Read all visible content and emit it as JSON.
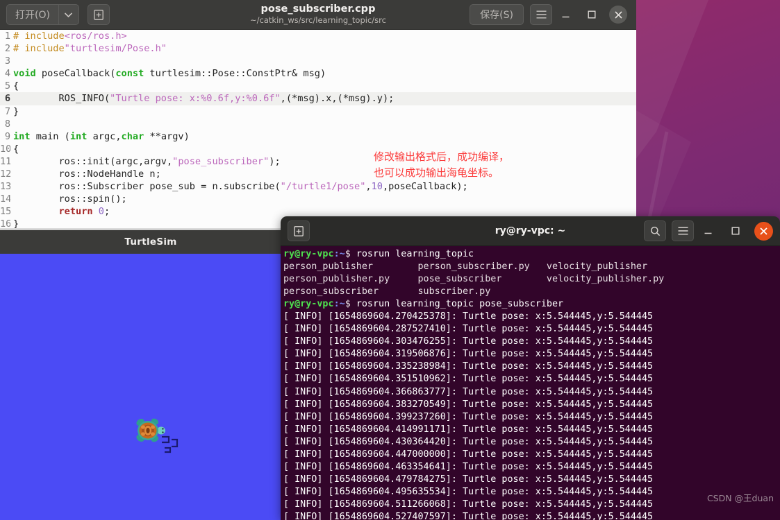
{
  "desktop": {
    "wallpaper_top_color": "#b5275c",
    "wallpaper_bottom_color": "#5e2470"
  },
  "gedit": {
    "open_label": "打开(O)",
    "open_dropdown_icon": "chevron-down-icon",
    "new_tab_icon": "new-tab-icon",
    "title": "pose_subscriber.cpp",
    "subtitle": "~/catkin_ws/src/learning_topic/src",
    "save_label": "保存(S)",
    "menu_icon": "hamburger-menu-icon",
    "minimize_icon": "minimize-icon",
    "maximize_icon": "maximize-icon",
    "close_icon": "close-icon",
    "current_line": 6,
    "annotation": "修改输出格式后，成功编译，\n也可以成功输出海龟坐标。",
    "annotation_color": "#fb3b3b",
    "lines": [
      {
        "n": "1",
        "tokens": [
          {
            "t": "# include",
            "c": "pp"
          },
          {
            "t": "<ros/ros.h>",
            "c": "str"
          }
        ]
      },
      {
        "n": "2",
        "tokens": [
          {
            "t": "# include",
            "c": "pp"
          },
          {
            "t": "\"turtlesim/Pose.h\"",
            "c": "str"
          }
        ]
      },
      {
        "n": "3",
        "tokens": []
      },
      {
        "n": "4",
        "tokens": [
          {
            "t": "void",
            "c": "kw"
          },
          {
            "t": " poseCallback(",
            "c": "ctext"
          },
          {
            "t": "const",
            "c": "kw"
          },
          {
            "t": " turtlesim::Pose::ConstPtr& msg)",
            "c": "ctext"
          }
        ]
      },
      {
        "n": "5",
        "tokens": [
          {
            "t": "{",
            "c": "ctext"
          }
        ]
      },
      {
        "n": "6",
        "tokens": [
          {
            "t": "        ROS_INFO(",
            "c": "ctext"
          },
          {
            "t": "\"Turtle pose: x:%0.6f,y:%0.6f\"",
            "c": "str"
          },
          {
            "t": ",(*msg).x,(*msg).y);",
            "c": "ctext"
          }
        ]
      },
      {
        "n": "7",
        "tokens": [
          {
            "t": "}",
            "c": "ctext"
          }
        ]
      },
      {
        "n": "8",
        "tokens": []
      },
      {
        "n": "9",
        "tokens": [
          {
            "t": "int",
            "c": "kw"
          },
          {
            "t": " main (",
            "c": "ctext"
          },
          {
            "t": "int",
            "c": "kw"
          },
          {
            "t": " argc,",
            "c": "ctext"
          },
          {
            "t": "char",
            "c": "kw"
          },
          {
            "t": " **argv)",
            "c": "ctext"
          }
        ]
      },
      {
        "n": "10",
        "tokens": [
          {
            "t": "{",
            "c": "ctext"
          }
        ]
      },
      {
        "n": "11",
        "tokens": [
          {
            "t": "        ros::init(argc,argv,",
            "c": "ctext"
          },
          {
            "t": "\"pose_subscriber\"",
            "c": "str"
          },
          {
            "t": ");",
            "c": "ctext"
          }
        ]
      },
      {
        "n": "12",
        "tokens": [
          {
            "t": "        ros::NodeHandle n;",
            "c": "ctext"
          }
        ]
      },
      {
        "n": "13",
        "tokens": [
          {
            "t": "        ros::Subscriber pose_sub = n.subscribe(",
            "c": "ctext"
          },
          {
            "t": "\"/turtle1/pose\"",
            "c": "str"
          },
          {
            "t": ",",
            "c": "ctext"
          },
          {
            "t": "10",
            "c": "num"
          },
          {
            "t": ",poseCallback);",
            "c": "ctext"
          }
        ]
      },
      {
        "n": "14",
        "tokens": [
          {
            "t": "        ros::spin();",
            "c": "ctext"
          }
        ]
      },
      {
        "n": "15",
        "tokens": [
          {
            "t": "        ",
            "c": "ctext"
          },
          {
            "t": "return",
            "c": "kw2"
          },
          {
            "t": " ",
            "c": "ctext"
          },
          {
            "t": "0",
            "c": "num"
          },
          {
            "t": ";",
            "c": "ctext"
          }
        ]
      },
      {
        "n": "16",
        "tokens": [
          {
            "t": "}",
            "c": "ctext"
          }
        ]
      }
    ]
  },
  "turtlesim": {
    "title": "TurtleSim",
    "canvas_color": "#4b4bf5"
  },
  "terminal": {
    "new_tab_icon": "new-tab-icon",
    "title": "ry@ry-vpc: ~",
    "search_icon": "search-icon",
    "menu_icon": "hamburger-menu-icon",
    "minimize_icon": "minimize-icon",
    "maximize_icon": "maximize-icon",
    "close_icon": "close-icon",
    "background_color": "#32052a",
    "prompt_user": "ry@ry-vpc",
    "prompt_path": ":~",
    "prompt_symbol": "$ ",
    "lines": [
      {
        "type": "prompt",
        "cmd": "rosrun learning_topic"
      },
      {
        "type": "out",
        "text": "person_publisher        person_subscriber.py   velocity_publisher"
      },
      {
        "type": "out",
        "text": "person_publisher.py     pose_subscriber        velocity_publisher.py"
      },
      {
        "type": "out",
        "text": "person_subscriber       subscriber.py"
      },
      {
        "type": "prompt",
        "cmd": "rosrun learning_topic pose_subscriber"
      },
      {
        "type": "info",
        "text": "[ INFO] [1654869604.270425378]: Turtle pose: x:5.544445,y:5.544445"
      },
      {
        "type": "info",
        "text": "[ INFO] [1654869604.287527410]: Turtle pose: x:5.544445,y:5.544445"
      },
      {
        "type": "info",
        "text": "[ INFO] [1654869604.303476255]: Turtle pose: x:5.544445,y:5.544445"
      },
      {
        "type": "info",
        "text": "[ INFO] [1654869604.319506876]: Turtle pose: x:5.544445,y:5.544445"
      },
      {
        "type": "info",
        "text": "[ INFO] [1654869604.335238984]: Turtle pose: x:5.544445,y:5.544445"
      },
      {
        "type": "info",
        "text": "[ INFO] [1654869604.351510962]: Turtle pose: x:5.544445,y:5.544445"
      },
      {
        "type": "info",
        "text": "[ INFO] [1654869604.366863777]: Turtle pose: x:5.544445,y:5.544445"
      },
      {
        "type": "info",
        "text": "[ INFO] [1654869604.383270549]: Turtle pose: x:5.544445,y:5.544445"
      },
      {
        "type": "info",
        "text": "[ INFO] [1654869604.399237260]: Turtle pose: x:5.544445,y:5.544445"
      },
      {
        "type": "info",
        "text": "[ INFO] [1654869604.414991171]: Turtle pose: x:5.544445,y:5.544445"
      },
      {
        "type": "info",
        "text": "[ INFO] [1654869604.430364420]: Turtle pose: x:5.544445,y:5.544445"
      },
      {
        "type": "info",
        "text": "[ INFO] [1654869604.447000000]: Turtle pose: x:5.544445,y:5.544445"
      },
      {
        "type": "info",
        "text": "[ INFO] [1654869604.463354641]: Turtle pose: x:5.544445,y:5.544445"
      },
      {
        "type": "info",
        "text": "[ INFO] [1654869604.479784275]: Turtle pose: x:5.544445,y:5.544445"
      },
      {
        "type": "info",
        "text": "[ INFO] [1654869604.495635534]: Turtle pose: x:5.544445,y:5.544445"
      },
      {
        "type": "info",
        "text": "[ INFO] [1654869604.511266068]: Turtle pose: x:5.544445,y:5.544445"
      },
      {
        "type": "info",
        "text": "[ INFO] [1654869604.527407597]: Turtle pose: x:5.544445,y:5.544445"
      }
    ]
  },
  "watermark": {
    "text": "CSDN @王duan"
  }
}
